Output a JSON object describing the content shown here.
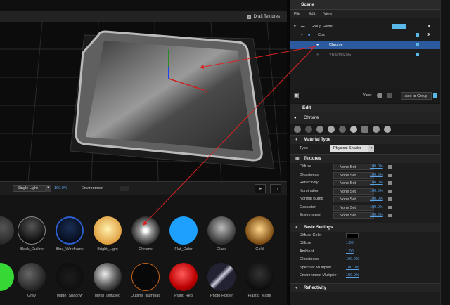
{
  "viewport": {
    "draft_textures_label": "Draft Textures",
    "light_select": "Single Light",
    "light_percent": "100.0%",
    "environment_label": "Environment"
  },
  "scene": {
    "title": "Scene",
    "menu": [
      "File",
      "Edit",
      "View"
    ],
    "tree": [
      {
        "label": "Group Folder",
        "x": "X"
      },
      {
        "label": "Cps",
        "x": "X"
      },
      {
        "label": "Chrome"
      },
      {
        "label": "VRayMtl25G"
      }
    ],
    "view_label": "View:",
    "add_group": "Add to Group"
  },
  "edit": {
    "title": "Edit",
    "material_name": "Chrome",
    "material_type_header": "Material Type",
    "type_label": "Type",
    "type_value": "Physical Shader",
    "textures_header": "Textures",
    "textures": [
      {
        "label": "Diffuse",
        "value": "None Set",
        "pct": "100.0%"
      },
      {
        "label": "Glossiness",
        "value": "None Set",
        "pct": "100.0%"
      },
      {
        "label": "Reflectivity",
        "value": "None Set",
        "pct": "100.0%"
      },
      {
        "label": "Illumination",
        "value": "None Set",
        "pct": "100.0%"
      },
      {
        "label": "Normal Bump",
        "value": "None Set",
        "pct": "100.0%"
      },
      {
        "label": "Occlusion",
        "value": "None Set",
        "pct": "100.0%"
      },
      {
        "label": "Environment",
        "value": "None Set",
        "pct": "100.0%"
      }
    ],
    "basic_header": "Basic Settings",
    "basic": [
      {
        "label": "Diffuse Color",
        "value": ""
      },
      {
        "label": "Diffuse",
        "value": "1.00"
      },
      {
        "label": "Ambient",
        "value": "1.00"
      },
      {
        "label": "Glossiness",
        "value": "100.0%"
      },
      {
        "label": "Specular Multiplier",
        "value": "100.0%"
      },
      {
        "label": "Environment Multiplier",
        "value": "100.0%"
      }
    ],
    "reflectivity_header": "Reflectivity"
  },
  "library": {
    "row1": [
      "",
      "Black_Outline",
      "Blue_Wireframe",
      "Bright_Light",
      "Chrome",
      "Flat_Color",
      "Glass",
      "Gold"
    ],
    "row2": [
      "",
      "Grey",
      "Matte_Shadow",
      "Metal_Diffused",
      "Outline_Illuminati",
      "Paint_Red",
      "Photo Holder",
      "Plastic_Matte"
    ]
  }
}
